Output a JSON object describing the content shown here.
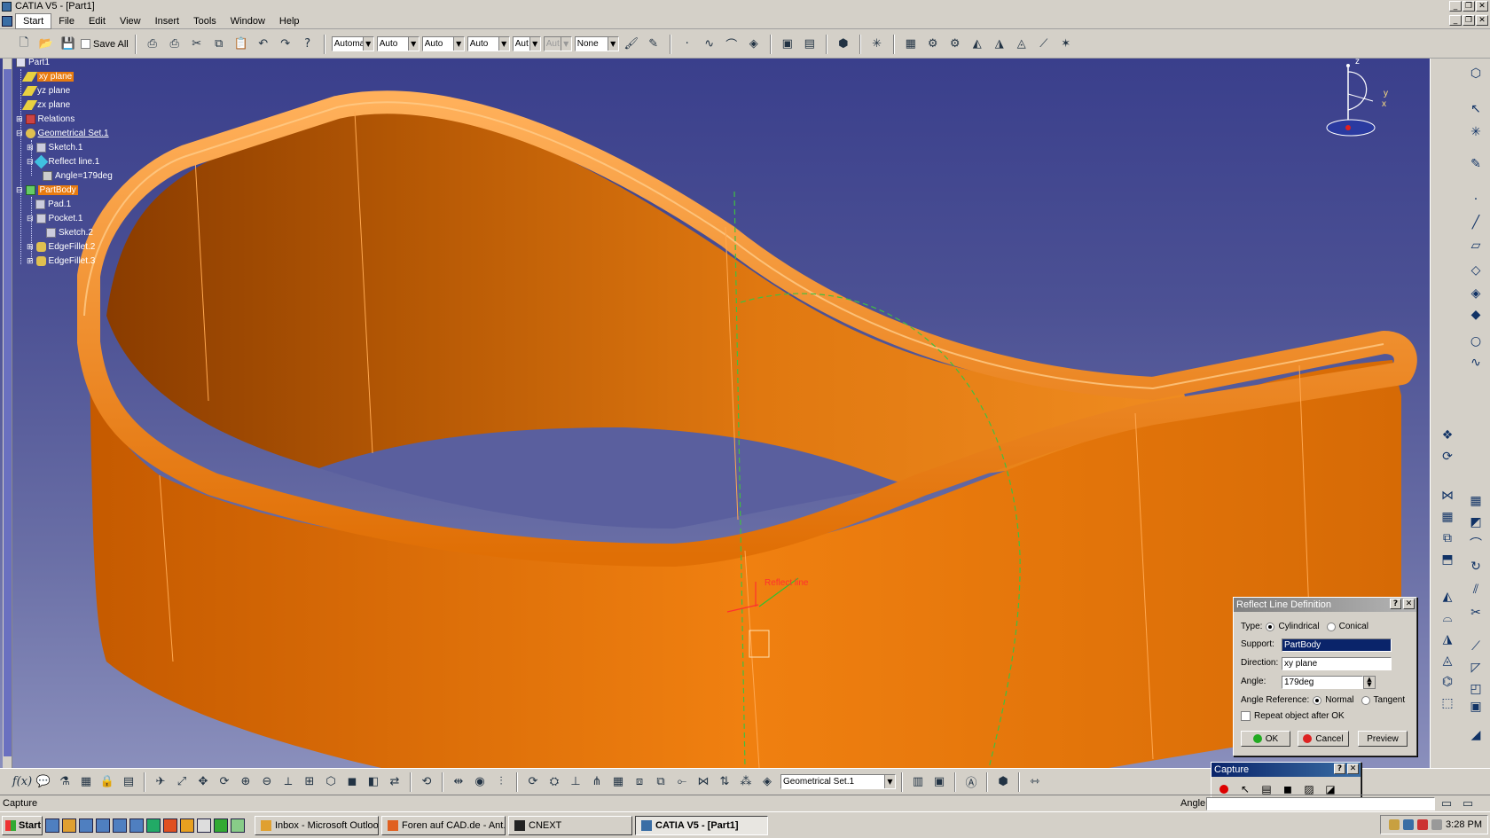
{
  "window": {
    "title": "CATIA V5 - [Part1]"
  },
  "menu": [
    "Start",
    "File",
    "Edit",
    "View",
    "Insert",
    "Tools",
    "Window",
    "Help"
  ],
  "toolbar_top": {
    "save_all": "Save All",
    "combo_1": "Automa",
    "combo_2": "Auto",
    "combo_3": "Auto",
    "combo_4": "Auto",
    "combo_5": "Aut",
    "combo_6": "Aut",
    "combo_7": "None"
  },
  "tree": [
    {
      "label": "Part1",
      "icon": "part-icon",
      "level": 0
    },
    {
      "label": "xy plane",
      "icon": "plane-icon",
      "level": 1,
      "selected": true
    },
    {
      "label": "yz plane",
      "icon": "plane-icon",
      "level": 1
    },
    {
      "label": "zx plane",
      "icon": "plane-icon",
      "level": 1
    },
    {
      "label": "Relations",
      "icon": "relations-icon",
      "level": 1
    },
    {
      "label": "Geometrical Set.1",
      "icon": "geometrical-set-icon",
      "level": 1,
      "underline": true
    },
    {
      "label": "Sketch.1",
      "icon": "sketch-icon",
      "level": 2
    },
    {
      "label": "Reflect line.1",
      "icon": "reflect-line-icon",
      "level": 2
    },
    {
      "label": "Angle=179deg",
      "icon": "parameter-icon",
      "level": 3
    },
    {
      "label": "PartBody",
      "icon": "body-icon",
      "level": 1,
      "selected": true
    },
    {
      "label": "Pad.1",
      "icon": "pad-icon",
      "level": 2
    },
    {
      "label": "Pocket.1",
      "icon": "pocket-icon",
      "level": 2
    },
    {
      "label": "Sketch.2",
      "icon": "sketch-icon",
      "level": 3
    },
    {
      "label": "EdgeFillet.2",
      "icon": "fillet-icon",
      "level": 2
    },
    {
      "label": "EdgeFillet.3",
      "icon": "fillet-icon",
      "level": 2
    }
  ],
  "compass": {
    "z": "z",
    "y": "y",
    "x": "x"
  },
  "viewport_label": "Reflect line",
  "reflect_dialog": {
    "title": "Reflect Line Definition",
    "type_label": "Type:",
    "type_options": [
      "Cylindrical",
      "Conical"
    ],
    "type_selected": "Cylindrical",
    "support_label": "Support:",
    "support_value": "PartBody",
    "direction_label": "Direction:",
    "direction_value": "xy plane",
    "angle_label": "Angle:",
    "angle_value": "179deg",
    "angle_ref_label": "Angle Reference:",
    "angle_ref_options": [
      "Normal",
      "Tangent"
    ],
    "angle_ref_selected": "Normal",
    "repeat_label": "Repeat object after OK",
    "ok": "OK",
    "cancel": "Cancel",
    "preview": "Preview"
  },
  "capture_dialog": {
    "title": "Capture"
  },
  "bottom_toolbar": {
    "fx": "f(x)",
    "set_combo": "Geometrical Set.1"
  },
  "status": {
    "text": "Capture",
    "angle_label": "Angle"
  },
  "taskbar": {
    "start": "Start",
    "tasks": [
      {
        "label": "Inbox - Microsoft Outlook",
        "active": false
      },
      {
        "label": "Foren auf CAD.de - Ant...",
        "active": false
      },
      {
        "label": "CNEXT",
        "active": false
      },
      {
        "label": "CATIA V5 - [Part1]",
        "active": true
      }
    ],
    "clock": "3:28 PM"
  },
  "colors": {
    "part": "#f07f10",
    "tree_selected": "#e87b10",
    "background_top": "#3a3f8c",
    "dialog_selection": "#0a246a"
  }
}
